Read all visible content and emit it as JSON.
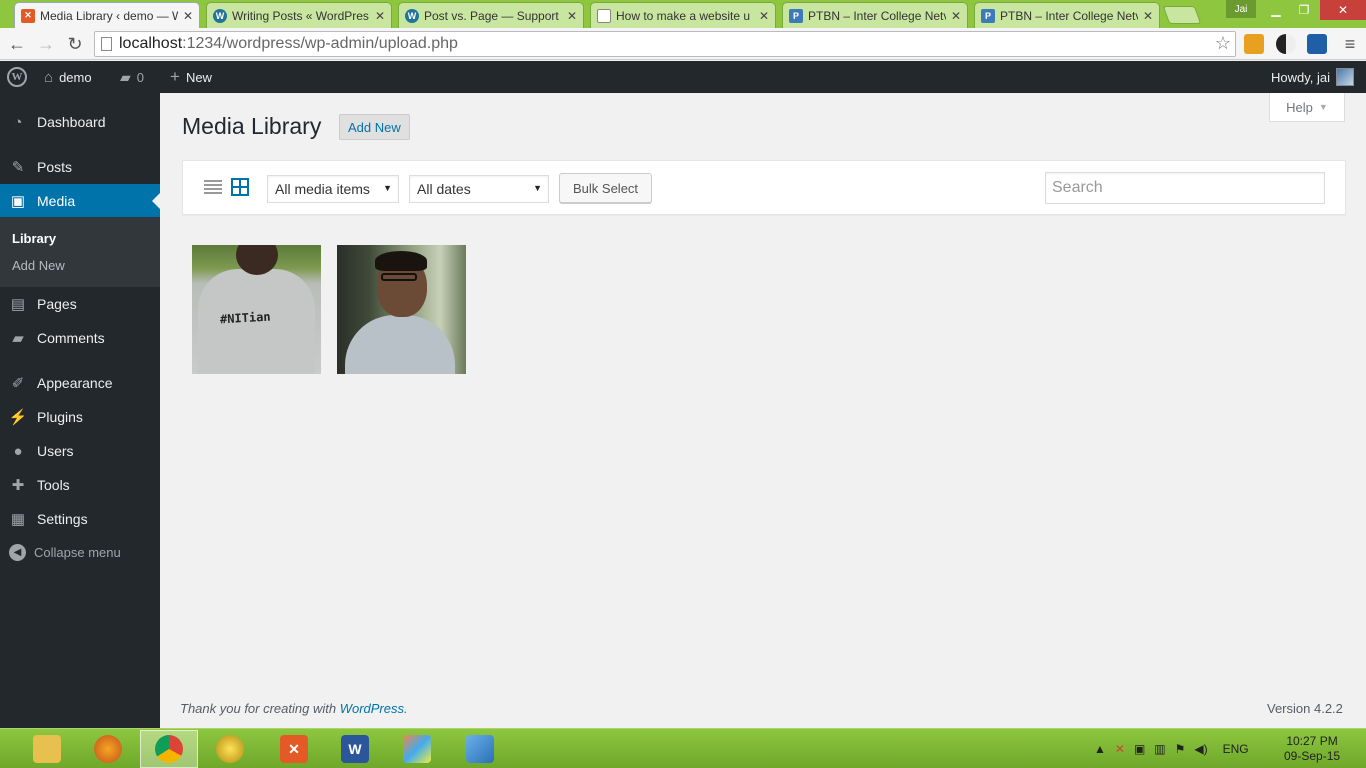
{
  "browser": {
    "tabs": [
      {
        "title": "Media Library ‹ demo — W",
        "favicon": "xampp",
        "active": true
      },
      {
        "title": "Writing Posts « WordPres",
        "favicon": "wp",
        "active": false
      },
      {
        "title": "Post vs. Page — Support -",
        "favicon": "wp",
        "active": false
      },
      {
        "title": "How to make a website u",
        "favicon": "doc",
        "active": false
      },
      {
        "title": "PTBN – Inter College Netv",
        "favicon": "p",
        "active": false
      },
      {
        "title": "PTBN – Inter College Netv",
        "favicon": "p",
        "active": false
      }
    ],
    "user_badge": "Jai",
    "url_host": "localhost",
    "url_path": ":1234/wordpress/wp-admin/upload.php"
  },
  "adminbar": {
    "site_name": "demo",
    "comments_count": "0",
    "new_label": "New",
    "howdy": "Howdy, jai"
  },
  "sidebar": {
    "items": [
      {
        "label": "Dashboard",
        "icon": "dashboard-icon"
      },
      {
        "label": "Posts",
        "icon": "pushpin-icon"
      },
      {
        "label": "Media",
        "icon": "media-icon"
      },
      {
        "label": "Pages",
        "icon": "pages-icon"
      },
      {
        "label": "Comments",
        "icon": "comment-icon"
      },
      {
        "label": "Appearance",
        "icon": "brush-icon"
      },
      {
        "label": "Plugins",
        "icon": "plugin-icon"
      },
      {
        "label": "Users",
        "icon": "user-icon"
      },
      {
        "label": "Tools",
        "icon": "wrench-icon"
      },
      {
        "label": "Settings",
        "icon": "settings-icon"
      }
    ],
    "submenu": [
      "Library",
      "Add New"
    ],
    "collapse_label": "Collapse menu"
  },
  "main": {
    "help_label": "Help",
    "title": "Media Library",
    "add_new_label": "Add New",
    "filter_type": "All media items",
    "filter_date": "All dates",
    "bulk_select_label": "Bulk Select",
    "search_placeholder": "Search",
    "thumb1_text": "#NITian"
  },
  "footer": {
    "thanks_prefix": "Thank you for creating with ",
    "thanks_link": "WordPress",
    "thanks_suffix": ".",
    "version": "Version 4.2.2"
  },
  "taskbar": {
    "language": "ENG",
    "time": "10:27 PM",
    "date": "09-Sep-15"
  },
  "colors": {
    "wp_blue": "#0073aa",
    "admin_dark": "#23282d",
    "taskbar_green": "#8dc63f"
  }
}
